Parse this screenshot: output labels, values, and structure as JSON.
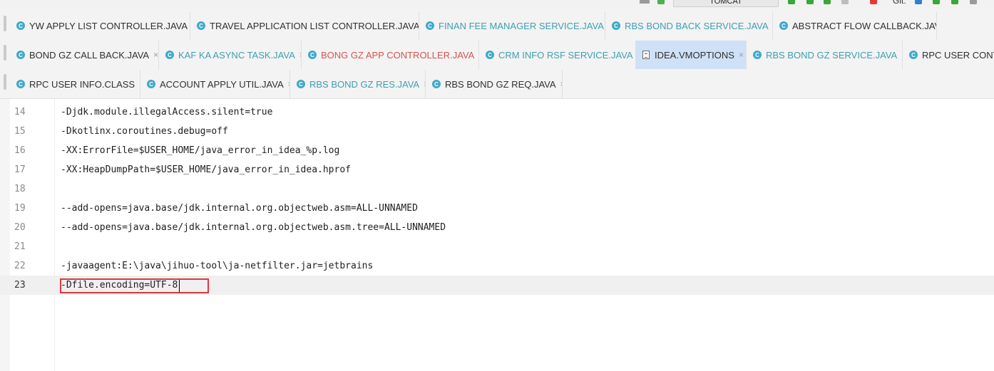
{
  "toolbar": {
    "run_config": "TOMCAT",
    "git_label": "Git:"
  },
  "tabs": {
    "row1": [
      {
        "label": "YW APPLY LIST CONTROLLER.JAVA",
        "icon": "class-icon",
        "color": "#303030"
      },
      {
        "label": "TRAVEL APPLICATION LIST CONTROLLER.JAVA",
        "icon": "class-icon",
        "color": "#303030"
      },
      {
        "label": "FINAN FEE MANAGER SERVICE.JAVA",
        "icon": "class-icon",
        "color": "#3d9fb2"
      },
      {
        "label": "RBS BOND BACK SERVICE.JAVA",
        "icon": "class-icon",
        "color": "#3d9fb2"
      },
      {
        "label": "ABSTRACT FLOW CALLBACK.JAVA",
        "icon": "class-icon",
        "color": "#303030"
      }
    ],
    "row2": [
      {
        "label": "BOND GZ CALL BACK.JAVA",
        "icon": "class-icon",
        "color": "#303030"
      },
      {
        "label": "KAF KA ASYNC TASK.JAVA",
        "icon": "class-icon",
        "color": "#3d9fb2"
      },
      {
        "label": "BONG GZ APP CONTROLLER.JAVA",
        "icon": "class-icon",
        "color": "#d9534f"
      },
      {
        "label": "CRM INFO RSF SERVICE.JAVA",
        "icon": "class-icon",
        "color": "#3d9fb2"
      },
      {
        "label": "IDEA.VMOPTIONS",
        "icon": "file-icon",
        "color": "#303030",
        "active": true
      },
      {
        "label": "RBS BOND GZ SERVICE.JAVA",
        "icon": "class-icon",
        "color": "#3d9fb2"
      },
      {
        "label": "RPC USER CONTE",
        "icon": "class-icon",
        "color": "#303030"
      }
    ],
    "row3": [
      {
        "label": "RPC USER INFO.CLASS",
        "icon": "class-icon",
        "color": "#303030"
      },
      {
        "label": "ACCOUNT APPLY UTIL.JAVA",
        "icon": "class-icon",
        "color": "#303030"
      },
      {
        "label": "RBS BOND GZ RES.JAVA",
        "icon": "class-icon",
        "color": "#3d9fb2"
      },
      {
        "label": "RBS BOND GZ REQ.JAVA",
        "icon": "class-icon",
        "color": "#303030"
      }
    ],
    "close_glyph": "×",
    "class_glyph": "C"
  },
  "editor": {
    "lines": [
      {
        "number": "14",
        "text": "-Djdk.module.illegalAccess.silent=true"
      },
      {
        "number": "15",
        "text": "-Dkotlinx.coroutines.debug=off"
      },
      {
        "number": "16",
        "text": "-XX:ErrorFile=$USER_HOME/java_error_in_idea_%p.log"
      },
      {
        "number": "17",
        "text": "-XX:HeapDumpPath=$USER_HOME/java_error_in_idea.hprof"
      },
      {
        "number": "18",
        "text": ""
      },
      {
        "number": "19",
        "text": "--add-opens=java.base/jdk.internal.org.objectweb.asm=ALL-UNNAMED"
      },
      {
        "number": "20",
        "text": "--add-opens=java.base/jdk.internal.org.objectweb.asm.tree=ALL-UNNAMED"
      },
      {
        "number": "21",
        "text": ""
      },
      {
        "number": "22",
        "text": "-javaagent:E:\\java\\jihuo-tool\\ja-netfilter.jar=jetbrains"
      },
      {
        "number": "23",
        "text": "-Dfile.encoding=UTF-8",
        "current": true
      }
    ]
  },
  "colors": {
    "highlight_border": "#e0383e",
    "active_tab": "#cfe1f7",
    "teal_label": "#3d9fb2",
    "red_label": "#d9534f"
  }
}
